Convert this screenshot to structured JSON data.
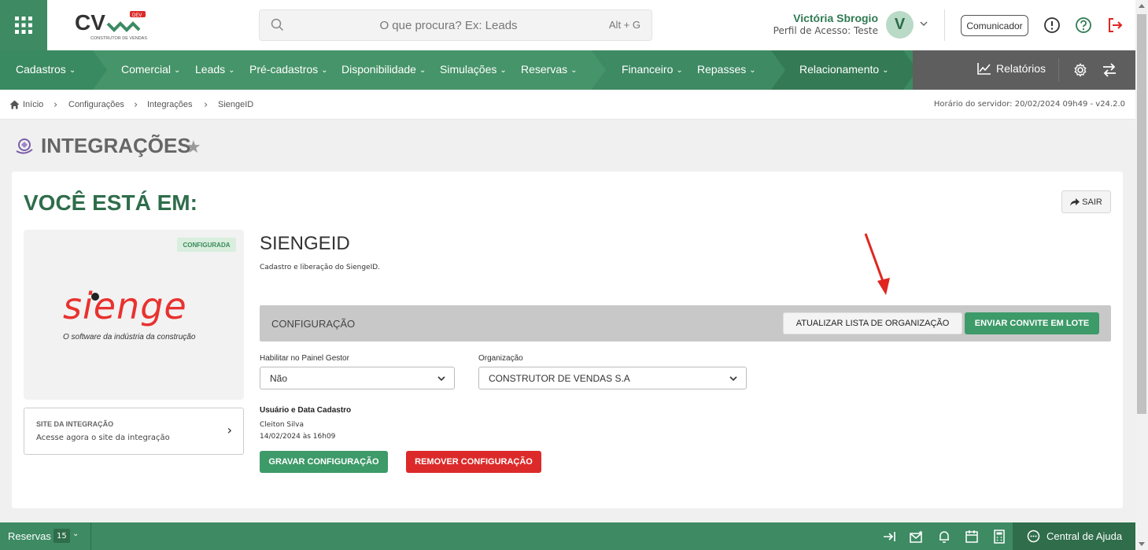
{
  "header": {
    "search_placeholder": "O que procura? Ex: Leads",
    "search_shortcut": "Alt + G",
    "user_name": "Victória Sbrogio",
    "user_profile": "Perfil de Acesso: Teste",
    "avatar_letter": "V",
    "comunicador_label": "Comunicador",
    "logo_text": "CV",
    "logo_badge": "DEV",
    "logo_sub": "CONSTRUTOR DE VENDAS"
  },
  "nav": {
    "items": [
      "Cadastros",
      "Comercial",
      "Leads",
      "Pré-cadastros",
      "Disponibilidade",
      "Simulações",
      "Reservas",
      "Financeiro",
      "Repasses",
      "Relacionamento"
    ],
    "reports_label": "Relatórios"
  },
  "breadcrumb": {
    "items": [
      "Início",
      "Configurações",
      "Integrações",
      "SiengeID"
    ],
    "server_time": "Horário do servidor: 20/02/2024 09h49 - v24.2.0"
  },
  "page": {
    "title": "INTEGRAÇÕES"
  },
  "card": {
    "heading": "VOCÊ ESTÁ EM:",
    "exit_label": "SAIR",
    "status_badge": "CONFIGURADA",
    "logo_word": "sienge",
    "logo_tagline": "O software da indústria da construção",
    "site_title": "SITE DA INTEGRAÇÃO",
    "site_desc": "Acesse agora o site da integração",
    "integration_title": "SIENGEID",
    "integration_desc": "Cadastro e liberação do SiengeID.",
    "config_label": "CONFIGURAÇÃO",
    "update_org_label": "ATUALIZAR LISTA DE ORGANIZAÇÃO",
    "send_invite_label": "ENVIAR CONVITE EM LOTE",
    "field_painel_label": "Habilitar no Painel Gestor",
    "field_painel_value": "Não",
    "field_org_label": "Organização",
    "field_org_value": "CONSTRUTOR DE VENDAS S.A",
    "meta_title": "Usuário e Data Cadastro",
    "meta_user": "Cleiton Silva",
    "meta_date": "14/02/2024 às 16h09",
    "save_label": "GRAVAR CONFIGURAÇÃO",
    "remove_label": "REMOVER CONFIGURAÇÃO"
  },
  "bottom": {
    "reservas_label": "Reservas",
    "reservas_count": "15",
    "help_label": "Central de Ajuda"
  },
  "colors": {
    "primary_green": "#3d8a63",
    "dark_green": "#2f6d4b",
    "danger": "#dc2a2a",
    "sienge_red": "#e8322f"
  }
}
